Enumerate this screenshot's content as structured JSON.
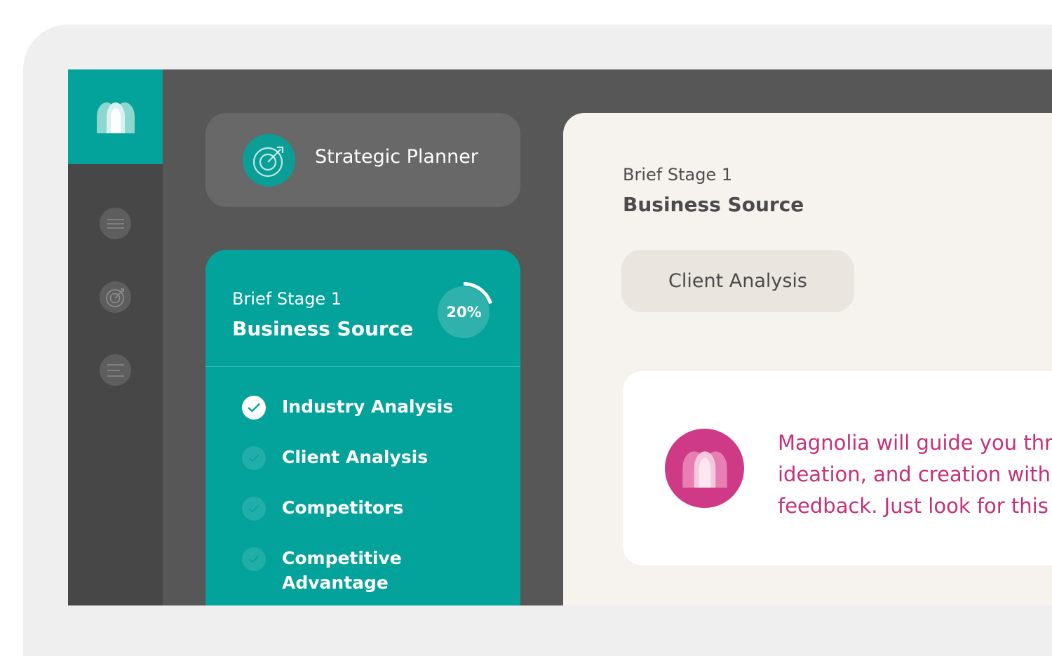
{
  "app": {
    "planner_title": "Strategic Planner",
    "accent_color": "#03a29b",
    "brand_pink": "#cf3a86"
  },
  "rail": {
    "logo_icon": "magnolia-arches-logo",
    "items": [
      {
        "icon": "menu-lines-icon"
      },
      {
        "icon": "target-icon"
      },
      {
        "icon": "text-align-icon"
      }
    ]
  },
  "stage": {
    "eyebrow": "Brief Stage 1",
    "name": "Business Source",
    "progress_label": "20%",
    "progress_value": 0.2,
    "tasks": [
      {
        "label": "Industry Analysis",
        "done": true
      },
      {
        "label": "Client Analysis",
        "done": false
      },
      {
        "label": "Competitors",
        "done": false
      },
      {
        "label": "Competitive Advantage",
        "done": false
      }
    ]
  },
  "content": {
    "eyebrow": "Brief Stage 1",
    "title": "Business Source",
    "chip_label": "Client Analysis",
    "tip_text": "Magnolia will guide you thr\nideation, and creation with\nfeedback. Just look for this"
  }
}
